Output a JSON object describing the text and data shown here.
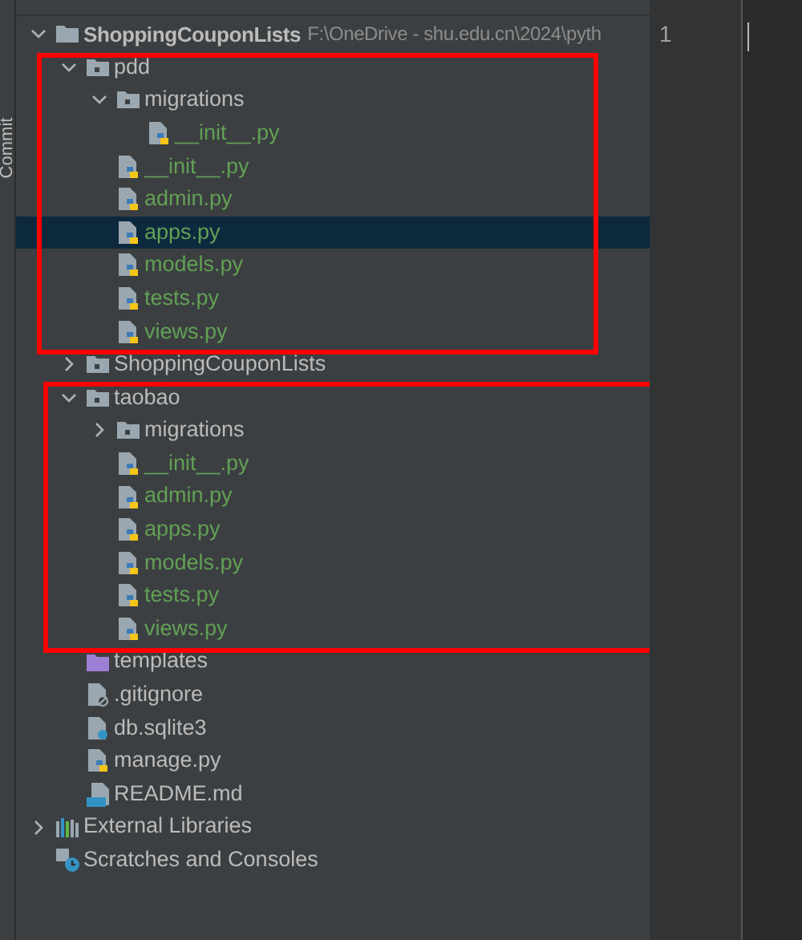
{
  "side_strip": {
    "label": "Commit"
  },
  "tree": [
    {
      "kind": "project",
      "name": "ShoppingCouponLists",
      "path": "F:\\OneDrive - shu.edu.cn\\2024\\pyth",
      "expanded": true,
      "selected": false,
      "added": false,
      "children": [
        {
          "kind": "package",
          "name": "pdd",
          "expanded": true,
          "selected": false,
          "added": false,
          "children": [
            {
              "kind": "package",
              "name": "migrations",
              "expanded": true,
              "selected": false,
              "added": false,
              "children": [
                {
                  "kind": "python",
                  "name": "__init__.py",
                  "selected": false,
                  "added": true
                }
              ]
            },
            {
              "kind": "python",
              "name": "__init__.py",
              "selected": false,
              "added": true
            },
            {
              "kind": "python",
              "name": "admin.py",
              "selected": false,
              "added": true
            },
            {
              "kind": "python",
              "name": "apps.py",
              "selected": true,
              "added": true
            },
            {
              "kind": "python",
              "name": "models.py",
              "selected": false,
              "added": true
            },
            {
              "kind": "python",
              "name": "tests.py",
              "selected": false,
              "added": true
            },
            {
              "kind": "python",
              "name": "views.py",
              "selected": false,
              "added": true
            }
          ]
        },
        {
          "kind": "package",
          "name": "ShoppingCouponLists",
          "expanded": false,
          "selected": false,
          "added": false
        },
        {
          "kind": "package",
          "name": "taobao",
          "expanded": true,
          "selected": false,
          "added": false,
          "children": [
            {
              "kind": "package",
              "name": "migrations",
              "expanded": false,
              "selected": false,
              "added": false
            },
            {
              "kind": "python",
              "name": "__init__.py",
              "selected": false,
              "added": true
            },
            {
              "kind": "python",
              "name": "admin.py",
              "selected": false,
              "added": true
            },
            {
              "kind": "python",
              "name": "apps.py",
              "selected": false,
              "added": true
            },
            {
              "kind": "python",
              "name": "models.py",
              "selected": false,
              "added": true
            },
            {
              "kind": "python",
              "name": "tests.py",
              "selected": false,
              "added": true
            },
            {
              "kind": "python",
              "name": "views.py",
              "selected": false,
              "added": true
            }
          ]
        },
        {
          "kind": "templates",
          "name": "templates",
          "selected": false,
          "added": false
        },
        {
          "kind": "ignore",
          "name": ".gitignore",
          "selected": false,
          "added": false
        },
        {
          "kind": "unknown",
          "name": "db.sqlite3",
          "selected": false,
          "added": false
        },
        {
          "kind": "python",
          "name": "manage.py",
          "selected": false,
          "added": false
        },
        {
          "kind": "markdown",
          "name": "README.md",
          "selected": false,
          "added": false
        }
      ]
    },
    {
      "kind": "libraries",
      "name": "External Libraries",
      "expanded": false,
      "selected": false,
      "added": false
    },
    {
      "kind": "scratches",
      "name": "Scratches and Consoles",
      "selected": false,
      "added": false
    }
  ],
  "editor": {
    "line_numbers": [
      "1"
    ]
  }
}
